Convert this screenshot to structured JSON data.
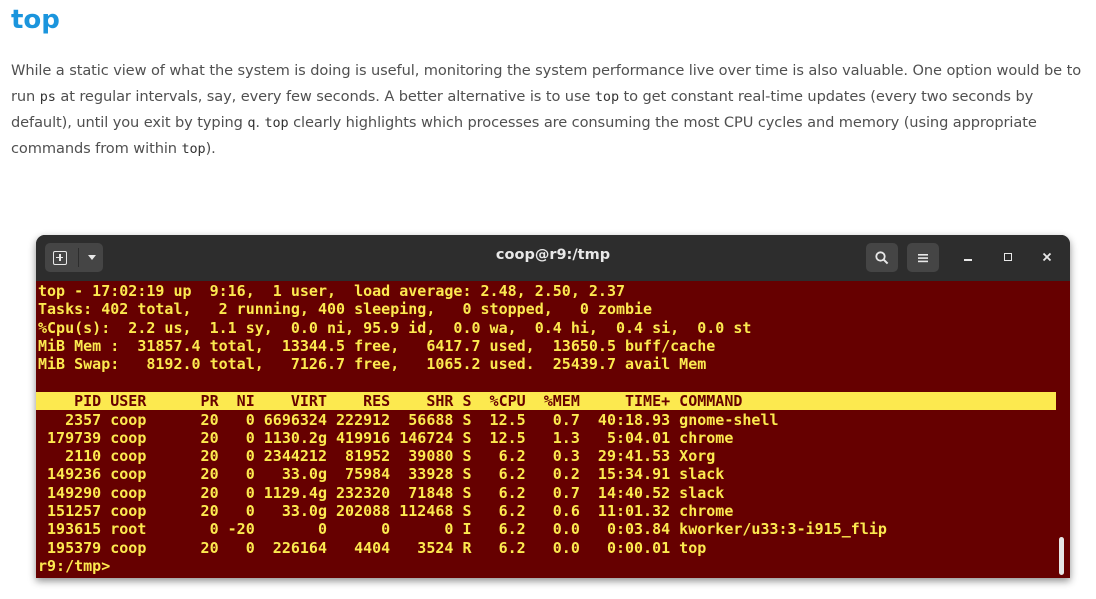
{
  "article": {
    "heading": "top",
    "paragraph": {
      "t1": "While a static view of what the system is doing is useful, monitoring the system performance live over time is also valuable. One option would be to run ",
      "c1": "ps",
      "t2": " at regular intervals, say, every few seconds. A better alternative is to use ",
      "c2": "top",
      "t3": " to get constant real-time updates (every two seconds by default), until you exit by typing ",
      "c3": "q",
      "t4": ". ",
      "c4": "top",
      "t5": " clearly highlights which processes are consuming the most CPU cycles and memory (using appropriate commands from within ",
      "c5": "top",
      "t6": ")."
    }
  },
  "terminal": {
    "title": "coop@r9:/tmp",
    "icons": {
      "new_tab": "new-tab-icon",
      "dropdown": "chevron-down-icon",
      "search": "search-icon",
      "menu": "hamburger-menu-icon",
      "minimize": "minimize-icon",
      "maximize": "maximize-icon",
      "close": "close-icon"
    },
    "close_glyph": "×",
    "colors": {
      "background": "#660000",
      "text": "#fce94f",
      "header_bg": "#fce94f",
      "titlebar": "#2d2d2d"
    },
    "summary": [
      "top - 17:02:19 up  9:16,  1 user,  load average: 2.48, 2.50, 2.37",
      "Tasks: 402 total,   2 running, 400 sleeping,   0 stopped,   0 zombie",
      "%Cpu(s):  2.2 us,  1.1 sy,  0.0 ni, 95.9 id,  0.0 wa,  0.4 hi,  0.4 si,  0.0 st",
      "MiB Mem :  31857.4 total,  13344.5 free,   6417.7 used,  13650.5 buff/cache",
      "MiB Swap:   8192.0 total,   7126.7 free,   1065.2 used.  25439.7 avail Mem"
    ],
    "process_header": "    PID USER      PR  NI    VIRT    RES    SHR S  %CPU  %MEM     TIME+ COMMAND",
    "processes": [
      "   2357 coop      20   0 6696324 222912  56688 S  12.5   0.7  40:18.93 gnome-shell",
      " 179739 coop      20   0 1130.2g 419916 146724 S  12.5   1.3   5:04.01 chrome",
      "   2110 coop      20   0 2344212  81952  39080 S   6.2   0.3  29:41.53 Xorg",
      " 149236 coop      20   0   33.0g  75984  33928 S   6.2   0.2  15:34.91 slack",
      " 149290 coop      20   0 1129.4g 232320  71848 S   6.2   0.7  14:40.52 slack",
      " 151257 coop      20   0   33.0g 202088 112468 S   6.2   0.6  11:01.32 chrome",
      " 193615 root       0 -20       0      0      0 I   6.2   0.0   0:03.84 kworker/u33:3-i915_flip",
      " 195379 coop      20   0  226164   4404   3524 R   6.2   0.0   0:00.01 top"
    ],
    "prompt": "r9:/tmp>"
  }
}
